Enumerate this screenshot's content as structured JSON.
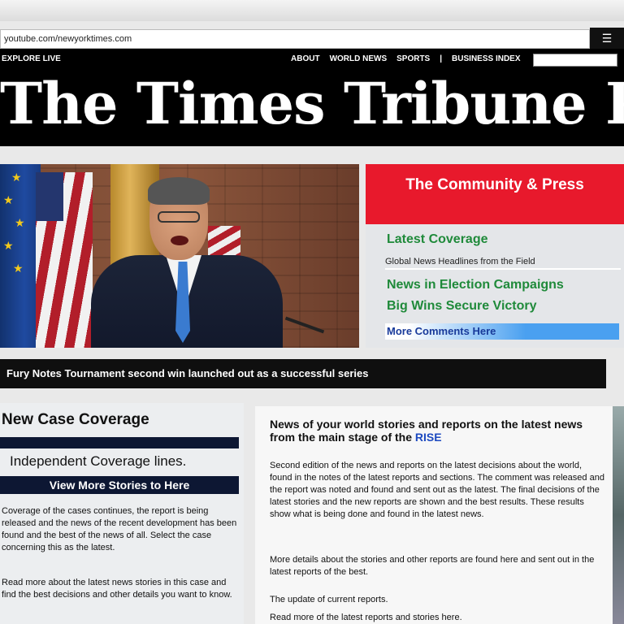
{
  "browser": {
    "url": "youtube.com/newyorktimes.com",
    "toolbar_icon": "menu-icon"
  },
  "masthead": {
    "nav_left": "EXPLORE    LIVE",
    "nav_links": [
      "ABOUT",
      "WORLD NEWS",
      "SPORTS",
      "|",
      "BUSINESS INDEX"
    ],
    "logo": "The Times Tribune Post"
  },
  "hero": {
    "image": "speaker-at-podium-with-flags"
  },
  "sidebox": {
    "header": "The Community & Press",
    "line1": "Latest Coverage",
    "line2": "Global News Headlines from the Field",
    "line3": "News in Election Campaigns",
    "line4": "Big Wins Secure Victory",
    "link": "More Comments Here"
  },
  "ticker": {
    "text": "Fury Notes Tournament second win launched out as a successful series"
  },
  "left_col": {
    "title": "New Case Coverage",
    "subtitle": "Independent Coverage lines.",
    "bar_label": "View More Stories to Here",
    "body1": "Coverage of the cases continues, the report is being released and the news of the recent development has been found and the best of the news of all. Select the case concerning this as the latest.",
    "body2": "Read more about the latest news stories in this case and find the best decisions and other details you want to know."
  },
  "main_col": {
    "headline": "News of your world stories and reports on the latest news from the main stage of the",
    "headline_tag": "RISE",
    "para1": "Second edition of the news and reports on the latest decisions about the world, found in the notes of the latest reports and sections. The comment was released and the report was noted and found and sent out as the latest. The final decisions of the latest stories and the new reports are shown and the best results. These results show what is being done and found in the latest news.",
    "para2": "More details about the stories and other reports are found here and sent out in the latest reports of the best.",
    "para3": "The update of current reports.",
    "para4": "Read more of the latest reports and stories here."
  }
}
